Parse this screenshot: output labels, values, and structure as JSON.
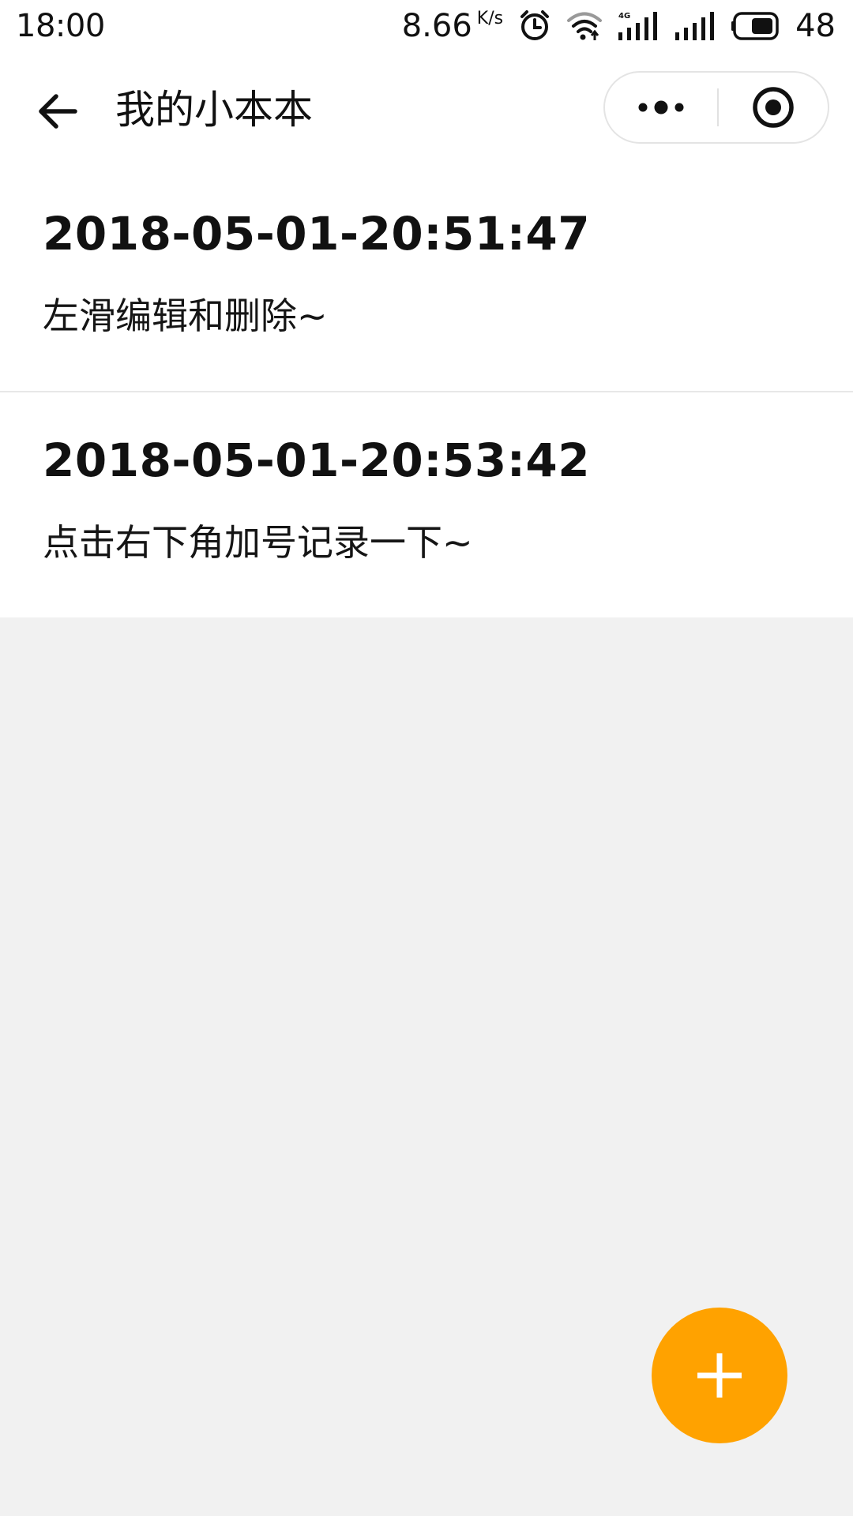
{
  "status_bar": {
    "time": "18:00",
    "net_speed": "8.66",
    "net_speed_unit": "K/s",
    "battery_level": "48",
    "icons": [
      "alarm-icon",
      "wifi-icon",
      "signal-4g-icon",
      "signal-icon",
      "battery-icon"
    ]
  },
  "nav": {
    "title": "我的小本本",
    "back_icon": "arrow-left-icon",
    "more_icon": "more-dots-icon",
    "close_icon": "target-close-icon"
  },
  "notes": [
    {
      "date": "2018-05-01-20:51:47",
      "content": "左滑编辑和删除~"
    },
    {
      "date": "2018-05-01-20:53:42",
      "content": "点击右下角加号记录一下~"
    }
  ],
  "fab": {
    "icon": "plus-icon"
  },
  "colors": {
    "accent": "#FFA200",
    "page_background": "#F1F1F1",
    "card_background": "#FFFFFF"
  }
}
